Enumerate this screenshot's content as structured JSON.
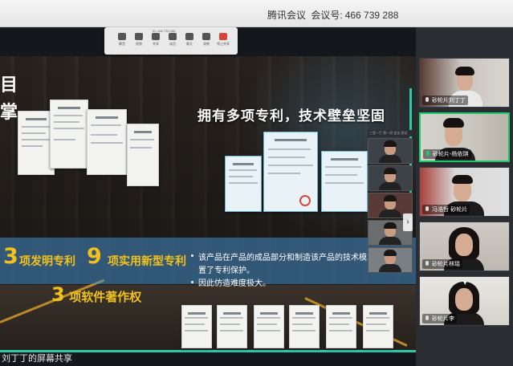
{
  "window": {
    "app_name": "腾讯会议",
    "meeting_id_label": "会议号:",
    "meeting_id": "466 739 288"
  },
  "slide": {
    "left_chars": [
      "目",
      "掌"
    ],
    "heading": "拥有多项专利，技术壁垒坚固",
    "stats": [
      {
        "number": "3",
        "label": "项发明专利"
      },
      {
        "number": "9",
        "label": "项实用新型专利"
      }
    ],
    "bullets": [
      "该产品在产品的成品部分和制造该产品的技术模块",
      "置了专利保护。",
      "因此仿造难度极大。"
    ],
    "software": {
      "number": "3",
      "label": "项软件著作权"
    }
  },
  "toolbar": {
    "info": "ID: 466 739 288",
    "items": [
      "静音",
      "视频",
      "共享",
      "成员",
      "聊天",
      "录制",
      "停止共享"
    ]
  },
  "share_caption": "刘丁丁的屏幕共享",
  "mini_gallery": {
    "bar_text": "三室一厅 第一排 会议 测试",
    "names": [
      "",
      "",
      "",
      "",
      ""
    ]
  },
  "participants": [
    {
      "name": "砂轮片刘丁丁",
      "active": false,
      "mic": "gray"
    },
    {
      "name": "砂轮片-杨依琪",
      "active": true,
      "mic": "green"
    },
    {
      "name": "冯浩哲 砂轮片",
      "active": false,
      "mic": "gray"
    },
    {
      "name": "砂轮片林瑶",
      "active": false,
      "mic": "gray"
    },
    {
      "name": "砂轮片李",
      "active": false,
      "mic": "gray"
    }
  ],
  "colors": {
    "accent_yellow": "#f2c21b",
    "active_border": "#1ec96a",
    "teal_line": "#2fc6a9"
  }
}
